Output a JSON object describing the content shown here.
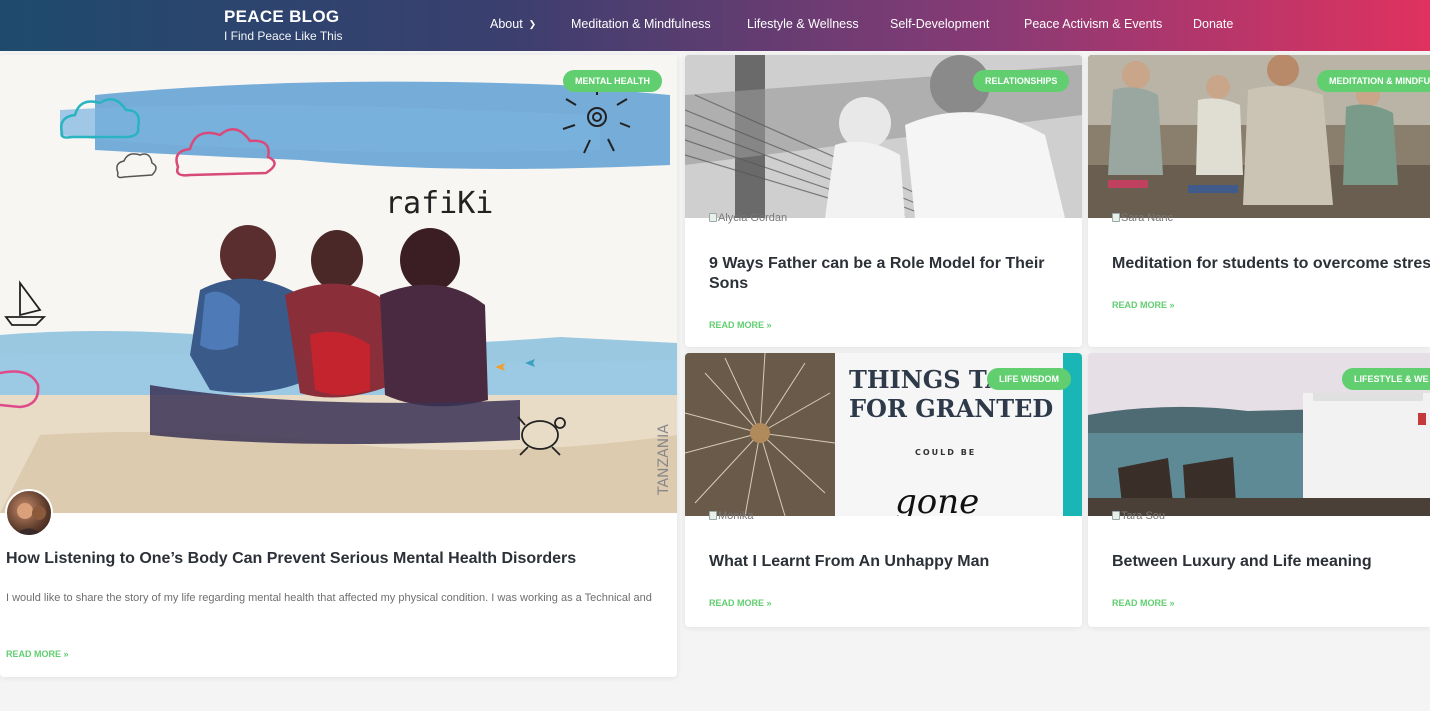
{
  "site": {
    "title": "PEACE BLOG",
    "tagline": "I Find Peace Like This"
  },
  "nav": [
    {
      "label": "About",
      "has_dropdown": true
    },
    {
      "label": "Meditation & Mindfulness"
    },
    {
      "label": "Lifestyle & Wellness"
    },
    {
      "label": "Self-Development"
    },
    {
      "label": "Peace Activism & Events"
    },
    {
      "label": "Donate"
    }
  ],
  "featured": {
    "category": "MENTAL HEALTH",
    "image_text": "rafiKi",
    "image_side_text": "TANZANIA",
    "title": "How Listening to One’s Body Can Prevent Serious Mental Health Disorders",
    "excerpt": "I would like to share the story of my life regarding mental health that affected my physical condition. I was working as a Technical and",
    "read_more": "READ MORE »"
  },
  "posts": [
    {
      "category": "RELATIONSHIPS",
      "author_alt": "Alycia Gordan",
      "title": "9 Ways Father can be a Role Model for Their Sons",
      "read_more": "READ MORE »"
    },
    {
      "category": "MEDITATION & MINDFU",
      "author_alt": "Sara Nanc",
      "title": "Meditation for students to overcome stress",
      "read_more": "READ MORE »"
    },
    {
      "category": "LIFE WISDOM",
      "author_alt": "Monika",
      "image_text": {
        "line1": "THINGS TA",
        "line2": "FOR GRANTED",
        "line3": "COULD BE",
        "line4": "gone"
      },
      "title": "What I Learnt From An Unhappy Man",
      "read_more": "READ MORE »"
    },
    {
      "category": "LIFESTYLE & WE",
      "author_alt": "Tara Sou",
      "title": "Between Luxury and Life meaning",
      "read_more": "READ MORE »"
    }
  ],
  "colors": {
    "accent": "#61ce70",
    "header_start": "#1e4a6e",
    "header_end": "#e0325f",
    "title": "#2c3137"
  }
}
